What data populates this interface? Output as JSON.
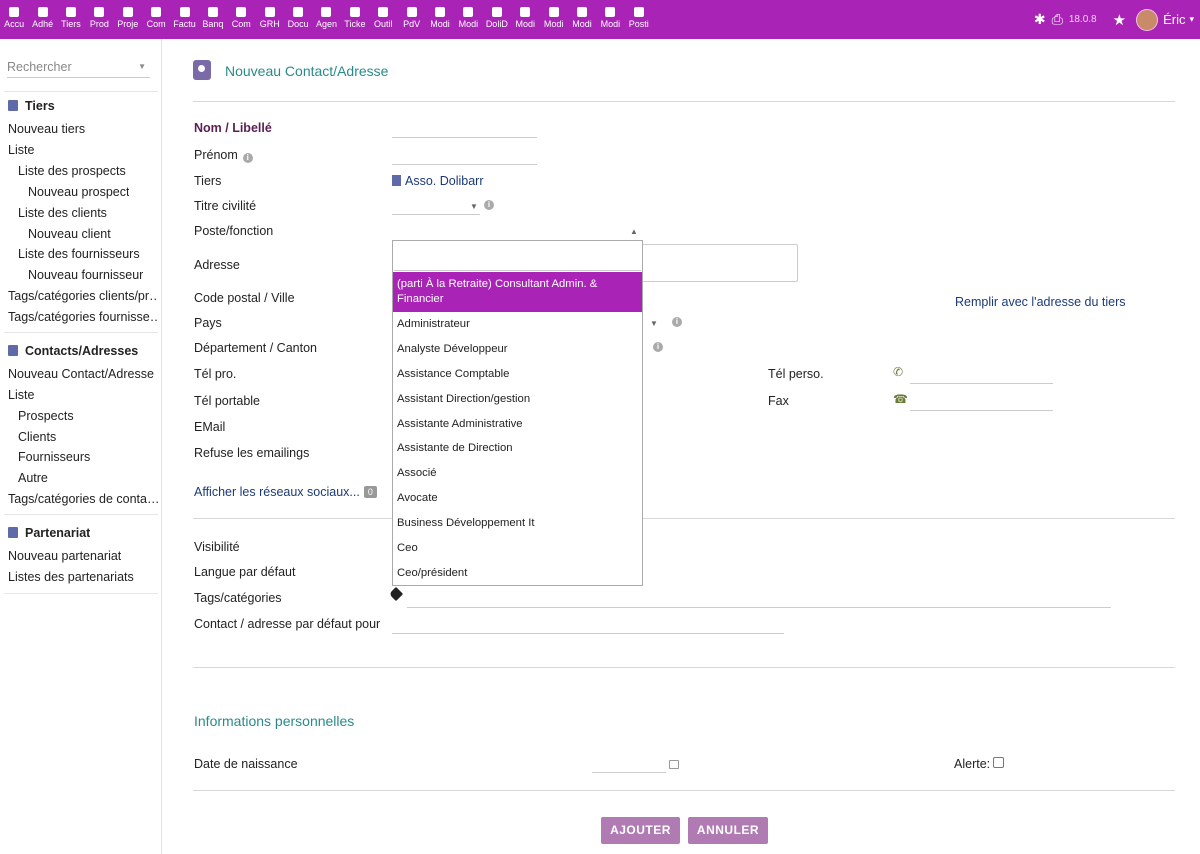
{
  "topbar": {
    "menu": [
      "Accu",
      "Adhé",
      "Tiers",
      "Prod",
      "Proje",
      "Com",
      "Factu",
      "Banq",
      "Com",
      "GRH",
      "Docu",
      "Agen",
      "Ticke",
      "Outil",
      "PdV",
      "Modi",
      "Modi",
      "DoliD",
      "Modi",
      "Modi",
      "Modi",
      "Modi",
      "Posti"
    ],
    "version": "18.0.8",
    "user": "Éric"
  },
  "sidebar": {
    "search_placeholder": "Rechercher",
    "tiers_head": "Tiers",
    "tiers_items": [
      "Nouveau tiers",
      "Liste",
      "Liste des prospects",
      "Nouveau prospect",
      "Liste des clients",
      "Nouveau client",
      "Liste des fournisseurs",
      "Nouveau fournisseur",
      "Tags/catégories clients/pr…",
      "Tags/catégories fournisse…"
    ],
    "contacts_head": "Contacts/Adresses",
    "contacts_items": [
      "Nouveau Contact/Adresse",
      "Liste",
      "Prospects",
      "Clients",
      "Fournisseurs",
      "Autre",
      "Tags/catégories de conta…"
    ],
    "partner_head": "Partenariat",
    "partner_items": [
      "Nouveau partenariat",
      "Listes des partenariats"
    ]
  },
  "page": {
    "title": "Nouveau Contact/Adresse",
    "labels": {
      "nom": "Nom / Libellé",
      "prenom": "Prénom",
      "tiers": "Tiers",
      "titre": "Titre civilité",
      "poste": "Poste/fonction",
      "adresse": "Adresse",
      "cp": "Code postal / Ville",
      "pays": "Pays",
      "dep": "Département / Canton",
      "telpro": "Tél pro.",
      "telperso": "Tél perso.",
      "telport": "Tél portable",
      "fax": "Fax",
      "email": "EMail",
      "refuse": "Refuse les emailings",
      "visibilite": "Visibilité",
      "langue": "Langue par défaut",
      "tags": "Tags/catégories",
      "contact_defaut": "Contact / adresse par défaut pour",
      "date_naissance": "Date de naissance",
      "alerte": "Alerte:"
    },
    "tiers_value": "Asso. Dolibarr",
    "fill_address_link": "Remplir avec l'adresse du tiers",
    "social_link": "Afficher les réseaux sociaux...",
    "social_count": "0",
    "personal_section": "Informations personnelles",
    "btn_add": "AJOUTER",
    "btn_cancel": "ANNULER"
  },
  "dropdown": {
    "options": [
      "(parti À la Retraite) Consultant Admin. & Financier",
      "Administrateur",
      "Analyste Développeur",
      "Assistance Comptable",
      "Assistant Direction/gestion",
      "Assistante Administrative",
      "Assistante de Direction",
      "Associé",
      "Avocate",
      "Business Développement It",
      "Ceo",
      "Ceo/président"
    ],
    "selected_index": 0
  },
  "colors": {
    "brand": "#a924b6",
    "link": "#1c3a79",
    "title": "#2a8a8a",
    "button": "#b07bb3"
  }
}
